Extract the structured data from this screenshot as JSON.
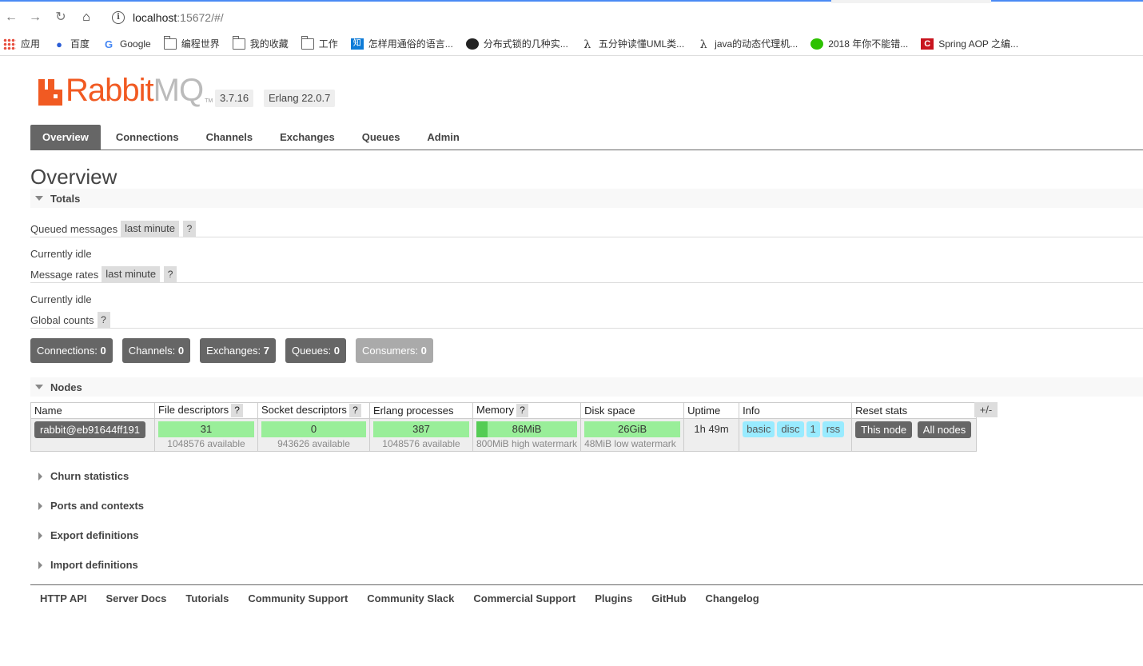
{
  "browser": {
    "url_host": "localhost",
    "url_rest": ":15672/#/",
    "bookmarks": [
      {
        "label": "应用",
        "icon": "apps-grid-icon"
      },
      {
        "label": "百度",
        "icon": "baidu-paw-icon"
      },
      {
        "label": "Google",
        "icon": "google-icon"
      },
      {
        "label": "编程世界",
        "icon": "folder-icon"
      },
      {
        "label": "我的收藏",
        "icon": "folder-icon"
      },
      {
        "label": "工作",
        "icon": "folder-icon"
      },
      {
        "label": "怎样用通俗的语言...",
        "icon": "zhihu-icon"
      },
      {
        "label": "分布式锁的几种实...",
        "icon": "globe-icon"
      },
      {
        "label": "五分钟读懂UML类...",
        "icon": "lambda-icon"
      },
      {
        "label": "java的动态代理机...",
        "icon": "lambda-icon"
      },
      {
        "label": "2018 年你不能错...",
        "icon": "wechat-icon"
      },
      {
        "label": "Spring AOP 之编...",
        "icon": "spring-icon"
      }
    ]
  },
  "app": {
    "logo_text_rabbit": "Rabbit",
    "logo_text_mq": "MQ",
    "logo_tm": "TM",
    "version": "3.7.16",
    "erlang": "Erlang 22.0.7"
  },
  "tabs": [
    "Overview",
    "Connections",
    "Channels",
    "Exchanges",
    "Queues",
    "Admin"
  ],
  "page_title": "Overview",
  "totals": {
    "heading": "Totals",
    "queued_messages_label": "Queued messages",
    "queued_messages_range": "last minute",
    "help": "?",
    "queued_status": "Currently idle",
    "message_rates_label": "Message rates",
    "message_rates_range": "last minute",
    "rates_status": "Currently idle",
    "global_counts_label": "Global counts"
  },
  "counts": [
    {
      "label": "Connections:",
      "value": "0"
    },
    {
      "label": "Channels:",
      "value": "0"
    },
    {
      "label": "Exchanges:",
      "value": "7"
    },
    {
      "label": "Queues:",
      "value": "0"
    },
    {
      "label": "Consumers:",
      "value": "0"
    }
  ],
  "nodes": {
    "heading": "Nodes",
    "columns": [
      "Name",
      "File descriptors",
      "Socket descriptors",
      "Erlang processes",
      "Memory",
      "Disk space",
      "Uptime",
      "Info",
      "Reset stats"
    ],
    "plus_minus": "+/-",
    "row": {
      "name": "rabbit@eb91644ff191",
      "file_descriptors": "31",
      "file_descriptors_avail": "1048576 available",
      "socket_descriptors": "0",
      "socket_descriptors_avail": "943626 available",
      "erlang_processes": "387",
      "erlang_processes_avail": "1048576 available",
      "memory": "86MiB",
      "memory_fraction": 0.1075,
      "memory_watermark": "800MiB high watermark",
      "disk": "26GiB",
      "disk_watermark": "48MiB low watermark",
      "uptime": "1h 49m",
      "info": [
        "basic",
        "disc",
        "1",
        "rss"
      ],
      "reset_this": "This node",
      "reset_all": "All nodes"
    }
  },
  "collapsed_sections": [
    "Churn statistics",
    "Ports and contexts",
    "Export definitions",
    "Import definitions"
  ],
  "footer_links": [
    "HTTP API",
    "Server Docs",
    "Tutorials",
    "Community Support",
    "Community Slack",
    "Commercial Support",
    "Plugins",
    "GitHub",
    "Changelog"
  ]
}
